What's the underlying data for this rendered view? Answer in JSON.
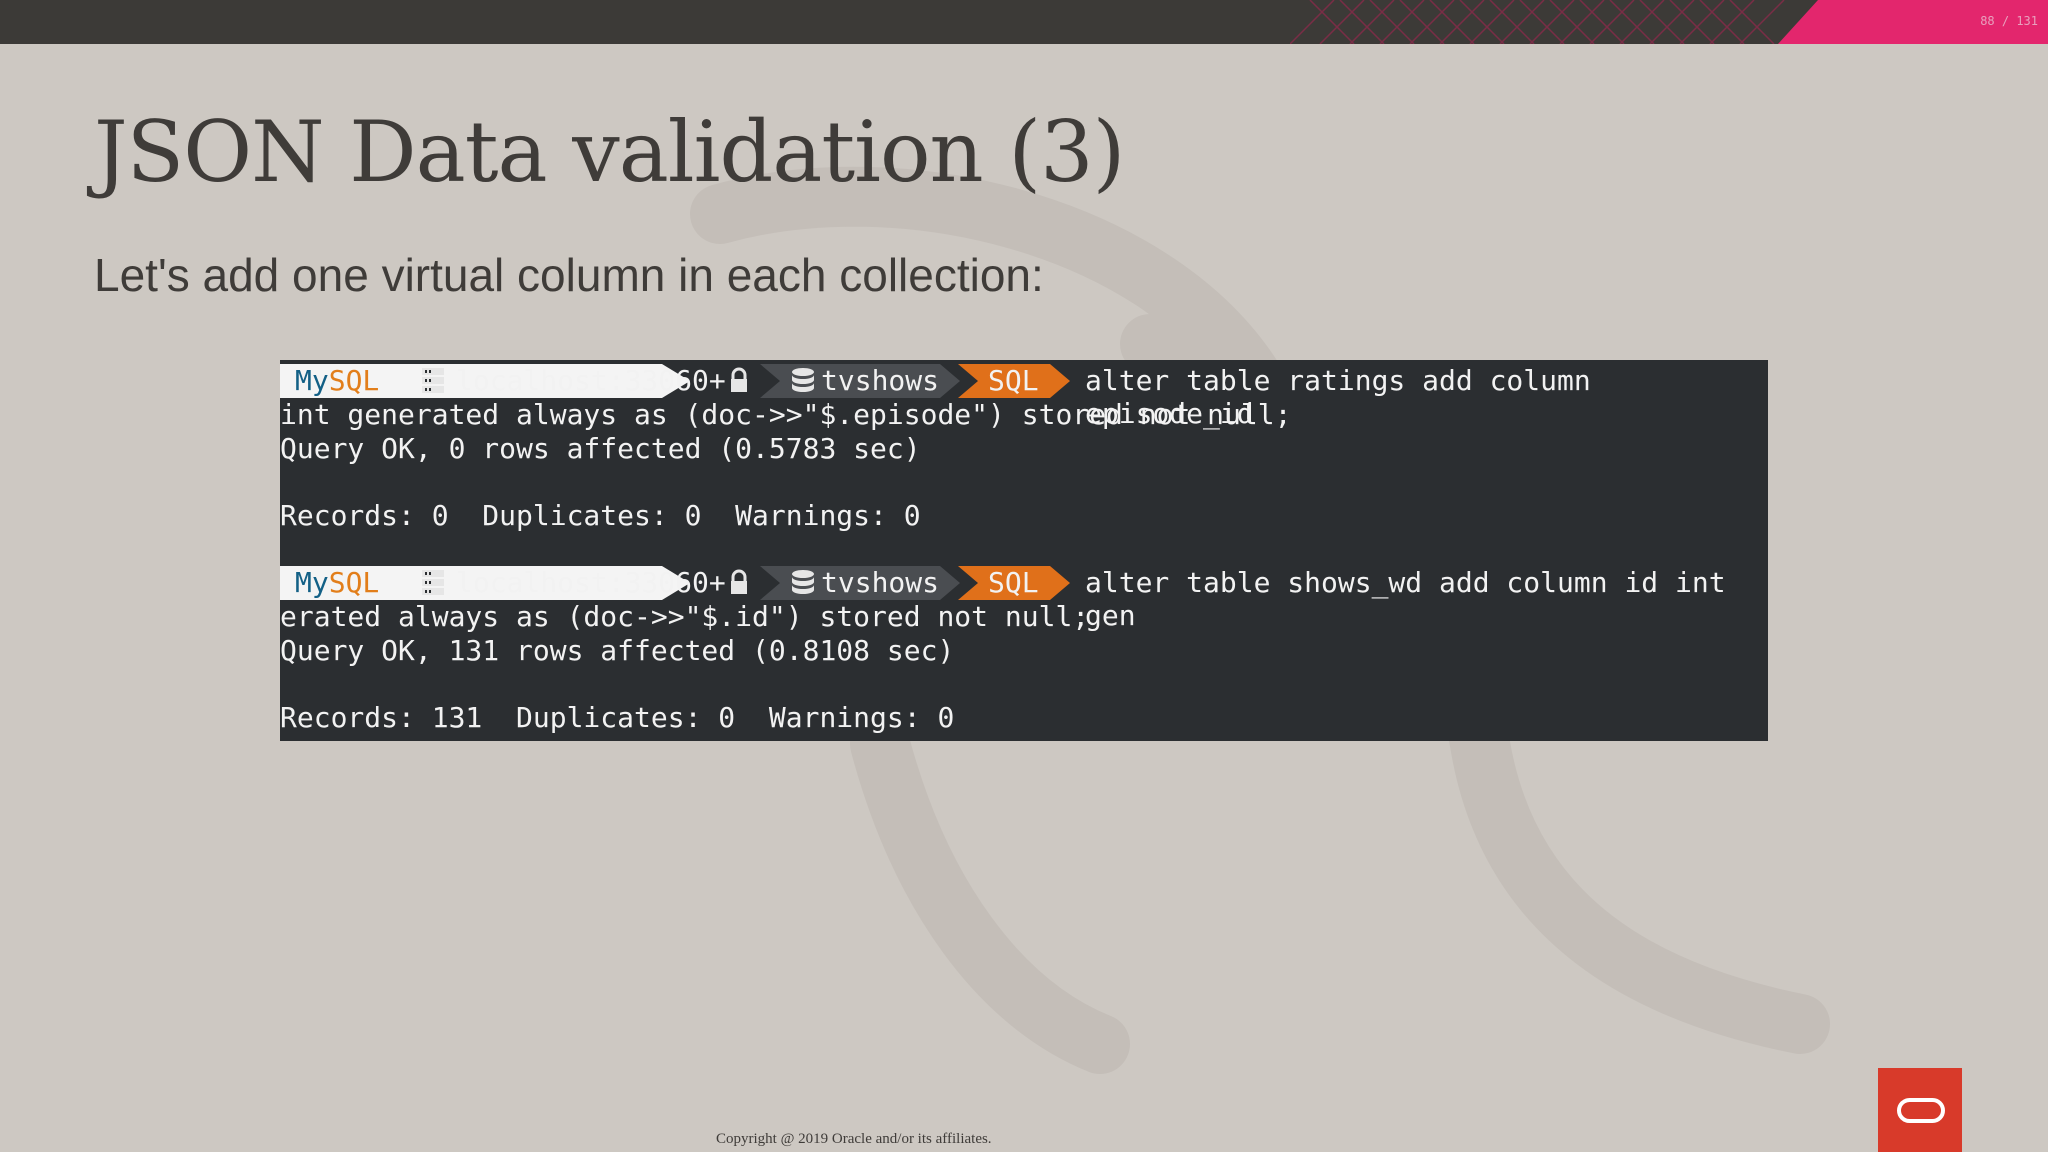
{
  "slide": {
    "number": "88 / 131",
    "title": "JSON Data validation (3)",
    "subtitle": "Let's add one virtual column in each collection:",
    "footer": "Copyright @ 2019 Oracle and/or its affiliates."
  },
  "terminal": {
    "prompt": {
      "mysql_my": "My",
      "mysql_sql": "SQL",
      "host": "localhost:33060+",
      "schema": "tvshows",
      "mode": "SQL"
    },
    "block1": {
      "cmd_line1": "alter table ratings add column episode_id",
      "cmd_line2": "int generated always as (doc->>\"$.episode\") stored not null;",
      "result": "Query OK, 0 rows affected (0.5783 sec)",
      "records": "Records: 0  Duplicates: 0  Warnings: 0"
    },
    "block2": {
      "cmd_line1": "alter table shows_wd add column id int gen",
      "cmd_line2": "erated always as (doc->>\"$.id\") stored not null;",
      "result": "Query OK, 131 rows affected (0.8108 sec)",
      "records": "Records: 131  Duplicates: 0  Warnings: 0"
    },
    "icons": [
      "server-icon",
      "lock-icon",
      "database-icon"
    ]
  },
  "colors": {
    "brand_pink": "#e3266d",
    "oracle_red": "#d83a2a",
    "terminal_bg": "#2b2e31",
    "sql_orange": "#e0701a",
    "mysql_blue": "#136086"
  }
}
